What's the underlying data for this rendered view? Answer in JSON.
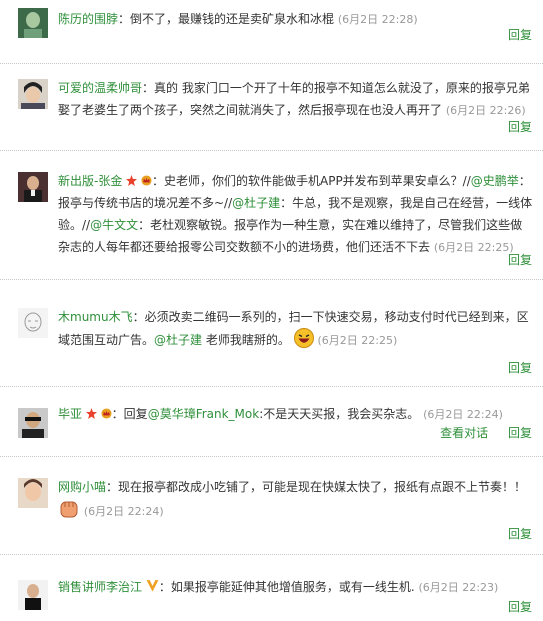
{
  "colors": {
    "link": "#2f8f3a",
    "time": "#999999",
    "text": "#333333"
  },
  "comments": [
    {
      "user": "陈历的围脖",
      "text": "：倒不了，最赚钱的还是卖矿泉水和冰棍",
      "time": "(6月2日 22:28)",
      "reply": "回复",
      "avatar_icon": "portrait-icon"
    },
    {
      "user": "可爱的温柔帅哥",
      "text": "：真的 我家门口一个开了十年的报亭不知道怎么就没了，原来的报亭兄弟娶了老婆生了两个孩子，突然之间就消失了，然后报亭现在也没人再开了",
      "time": "(6月2日 22:26)",
      "reply": "回复",
      "avatar_icon": "portrait-icon"
    },
    {
      "user": "新出版-张金",
      "text1": "：史老师，你们的软件能做手机APP并发布到苹果安卓么？//",
      "mention1": "@史鹏举",
      "text2": "：报亭与传统书店的境况差不多~//",
      "mention2": "@杜子建",
      "text3": "：牛总，我不是观察，我是自己在经营，一线体验。//",
      "mention3": "@牛文文",
      "text4": "：老杜观察敏锐。报亭作为一种生意，实在难以维持了，尽管我们这些做杂志的人每年都还要给报零公司交数额不小的进场费，他们还活不下去",
      "time": "(6月2日 22:25)",
      "reply": "回复",
      "avatar_icon": "portrait-icon"
    },
    {
      "user": "木mumu木飞",
      "text": "：必须改卖二维码一系列的，扫一下快速交易，移动支付时代已经到来，区域范围互动广告。",
      "mention": "@杜子建",
      "text2": " 老师我瞎掰的。",
      "time": "(6月2日 22:25)",
      "reply": "回复",
      "avatar_icon": "sketch-icon"
    },
    {
      "user": "毕亚",
      "text": "：回复",
      "mention": "@莫华璋Frank_Mok",
      "text2": ":不是天天买报，我会买杂志。",
      "time": "(6月2日 22:24)",
      "view_thread": "查看对话",
      "reply": "回复",
      "avatar_icon": "portrait-icon"
    },
    {
      "user": "网购小喵",
      "text": "：现在报亭都改成小吃铺了，可能是现在快媒太快了，报纸有点跟不上节奏！！",
      "time": "(6月2日 22:24)",
      "reply": "回复",
      "avatar_icon": "portrait-icon"
    },
    {
      "user": "销售讲师李治江",
      "text": "：如果报亭能延伸其他增值服务，或有一线生机.",
      "time": "(6月2日 22:23)",
      "reply": "回复",
      "avatar_icon": "portrait-icon"
    }
  ]
}
